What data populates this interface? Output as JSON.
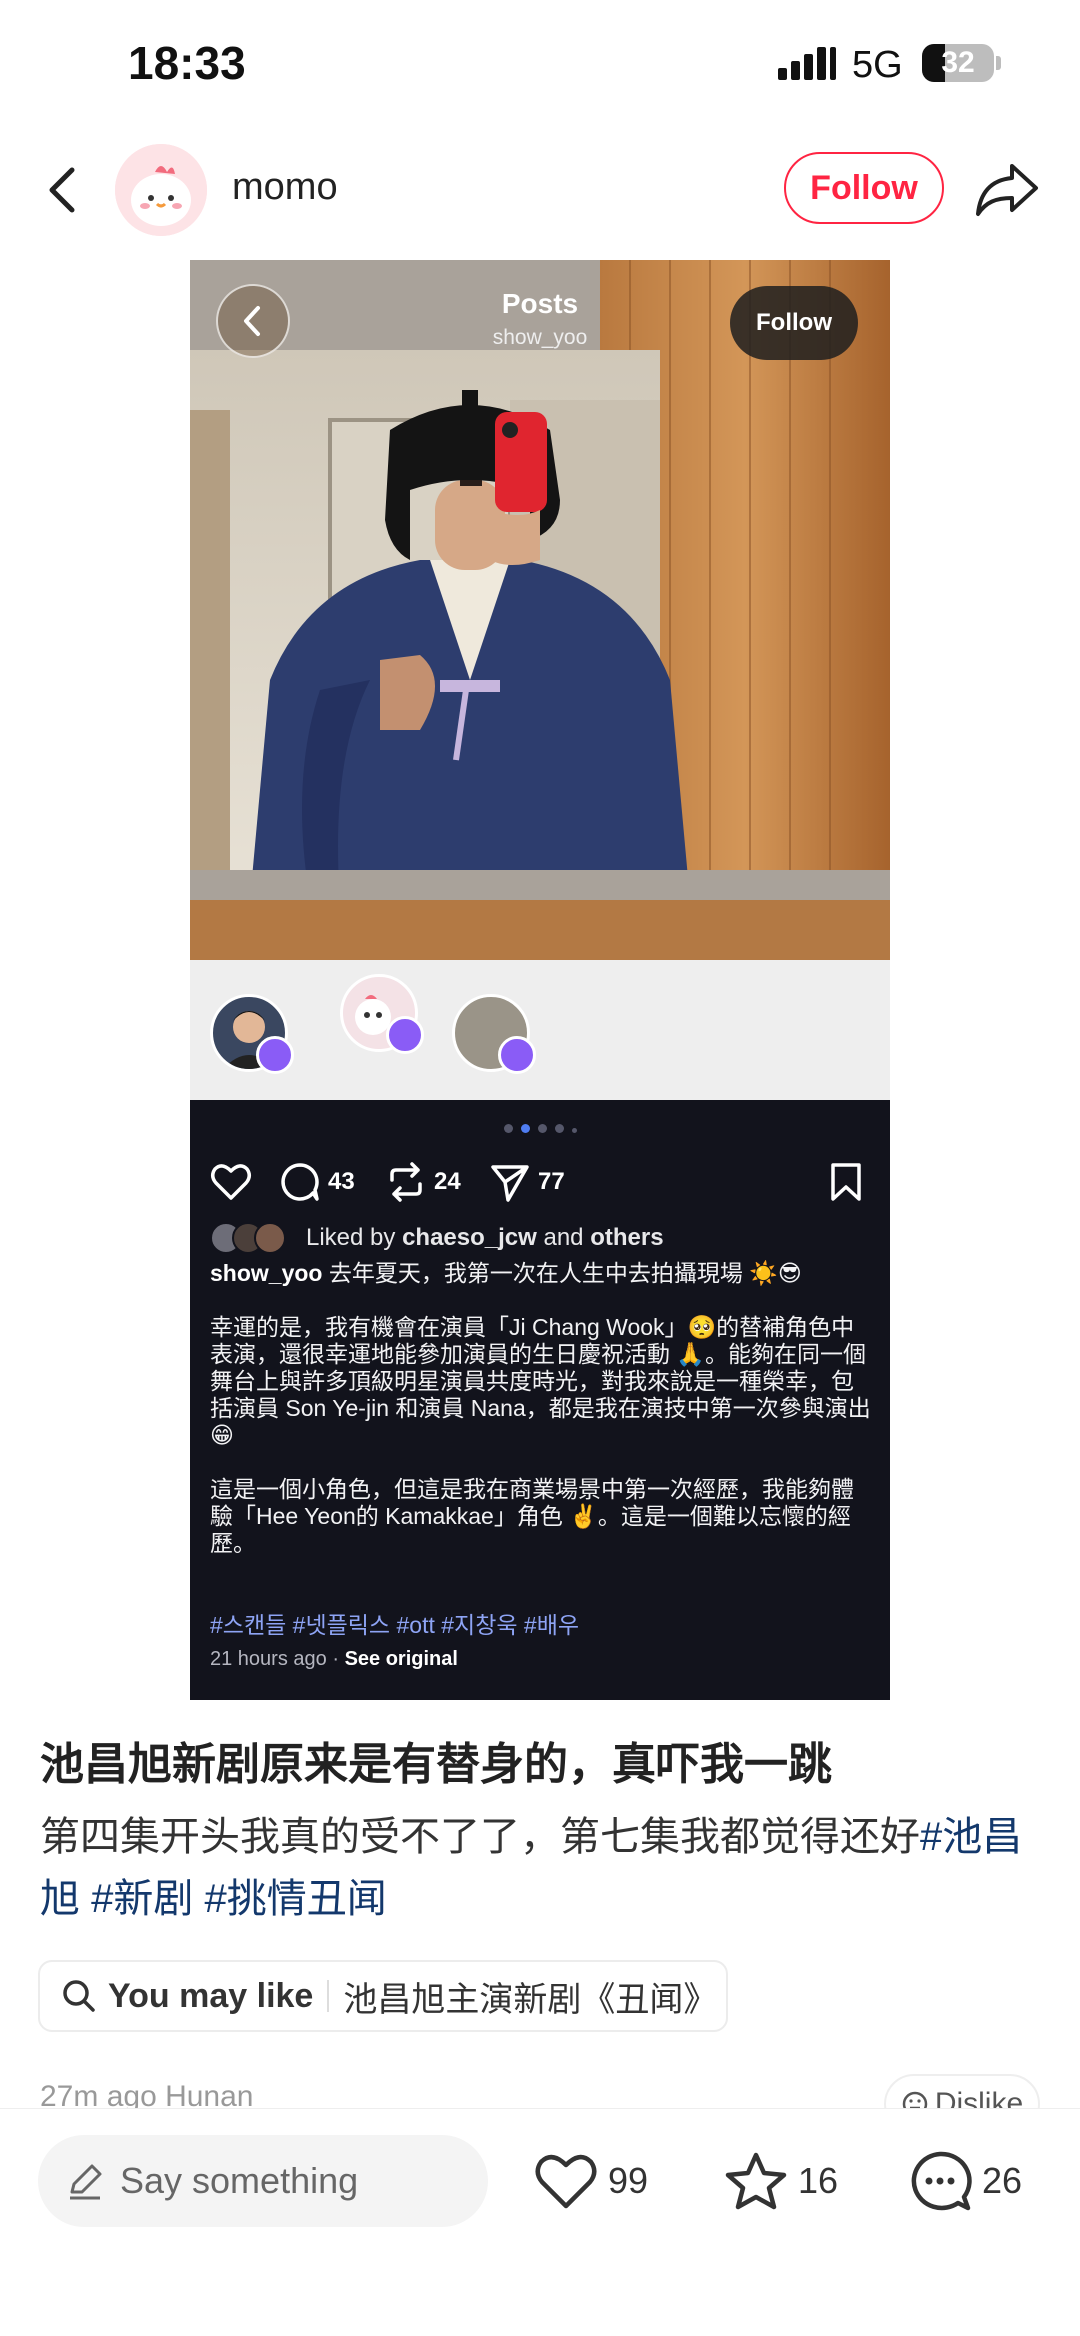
{
  "status_bar": {
    "time": "18:33",
    "network": "5G",
    "battery": "32",
    "battery_level": 0.32
  },
  "header": {
    "author": "momo",
    "follow_label": "Follow"
  },
  "embedded_post": {
    "title": "Posts",
    "username_sub": "show_yoo",
    "follow_label": "Follow",
    "comments": "43",
    "reposts": "24",
    "shares": "77",
    "liked_prefix": "Liked by",
    "liked_user": "chaeso_jcw",
    "liked_and": "and",
    "liked_others": "others",
    "author": "show_yoo",
    "caption_line1": "去年夏天，我第一次在人生中去拍攝現場 ☀️😎",
    "caption_p2": "幸運的是，我有機會在演員「Ji Chang Wook」🥺的替補角色中表演，還很幸運地能參加演員的生日慶祝活動 🙏。能夠在同一個舞台上與許多頂級明星演員共度時光，對我來說是一種榮幸，包括演員 Son Ye-jin 和演員 Nana，都是我在演技中第一次參與演出 😁",
    "caption_p3": "這是一個小角色，但這是我在商業場景中第一次經歷，我能夠體驗「Hee Yeon的 Kamakkae」角色 ✌️。這是一個難以忘懷的經歷。",
    "hashtags": "#스캔들 #넷플릭스 #ott #지창욱 #배우",
    "time_ago": "21 hours ago",
    "separator": "·",
    "see_original": "See original"
  },
  "post": {
    "title": "池昌旭新剧原来是有替身的，真吓我一跳",
    "body_text": "第四集开头我真的受不了了，第七集我都觉得还好",
    "tag1": "#池昌旭",
    "tag2": "#新剧",
    "tag3": "#挑情丑闻",
    "may_like_label": "You may like",
    "may_like_text": "池昌旭主演新剧《丑闻》",
    "meta": "27m ago Hunan",
    "dislike_label": "Dislike"
  },
  "bottom_bar": {
    "comment_placeholder": "Say something",
    "likes": "99",
    "stars": "16",
    "comments": "26"
  },
  "colors": {
    "accent": "#ff2442",
    "tag": "#13386c",
    "ig_bg": "#12131c",
    "ig_tag": "#8ea4f5"
  }
}
